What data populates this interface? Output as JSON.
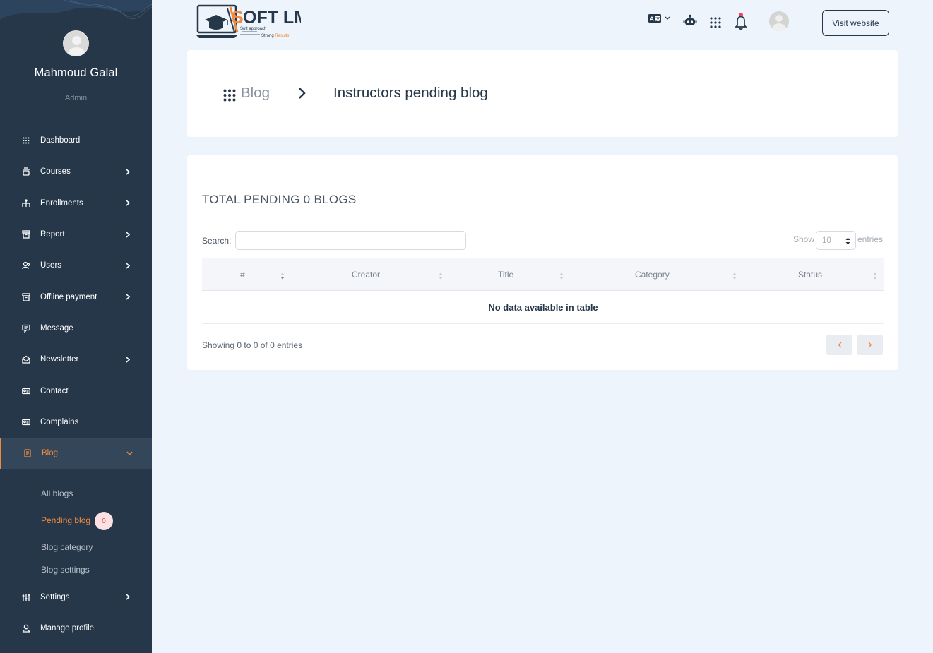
{
  "sidebar": {
    "user": {
      "name": "Mahmoud Galal",
      "role": "Admin"
    },
    "items": [
      {
        "label": "Dashboard",
        "icon": "dashboard-grid-icon",
        "has_submenu": false
      },
      {
        "label": "Courses",
        "icon": "courses-icon",
        "has_submenu": true
      },
      {
        "label": "Enrollments",
        "icon": "enrollments-icon",
        "has_submenu": true
      },
      {
        "label": "Report",
        "icon": "report-icon",
        "has_submenu": true
      },
      {
        "label": "Users",
        "icon": "users-icon",
        "has_submenu": true
      },
      {
        "label": "Offline payment",
        "icon": "offline-payment-icon",
        "has_submenu": true
      },
      {
        "label": "Message",
        "icon": "message-icon",
        "has_submenu": false
      },
      {
        "label": "Newsletter",
        "icon": "newsletter-icon",
        "has_submenu": true
      },
      {
        "label": "Contact",
        "icon": "contact-icon",
        "has_submenu": false
      },
      {
        "label": "Complains",
        "icon": "complains-icon",
        "has_submenu": false
      },
      {
        "label": "Blog",
        "icon": "blog-icon",
        "has_submenu": true,
        "active": true
      }
    ],
    "blog_submenu": [
      {
        "label": "All blogs"
      },
      {
        "label": "Pending blog",
        "active": true,
        "badge": "0"
      },
      {
        "label": "Blog category"
      },
      {
        "label": "Blog settings"
      }
    ],
    "bottom_items": [
      {
        "label": "Settings",
        "icon": "settings-sliders-icon",
        "has_submenu": true
      },
      {
        "label": "Manage profile",
        "icon": "profile-icon",
        "has_submenu": false
      }
    ]
  },
  "header": {
    "logo_text": "SOFT LMS",
    "logo_tagline_1": "Soft approach",
    "logo_tagline_2": "Strong Results",
    "visit_label": "Visit website",
    "icons": [
      "language-icon",
      "robot-icon",
      "apps-grid-icon",
      "notification-bell-icon",
      "user-avatar"
    ]
  },
  "breadcrumb": {
    "parent": "Blog",
    "current": "Instructors pending blog"
  },
  "table_section": {
    "heading": "TOTAL PENDING 0 BLOGS",
    "search_label": "Search:",
    "search_value": "",
    "show_label": "Show",
    "entries_value": "10",
    "entries_label": "entries",
    "columns": [
      "#",
      "Creator",
      "Title",
      "Category",
      "Status"
    ],
    "rows": [],
    "empty_message": "No data available in table",
    "info": "Showing 0 to 0 of 0 entries"
  },
  "colors": {
    "sidebar_bg": "#26374a",
    "accent": "#f08a3c",
    "page_bg": "#eef4fb"
  }
}
